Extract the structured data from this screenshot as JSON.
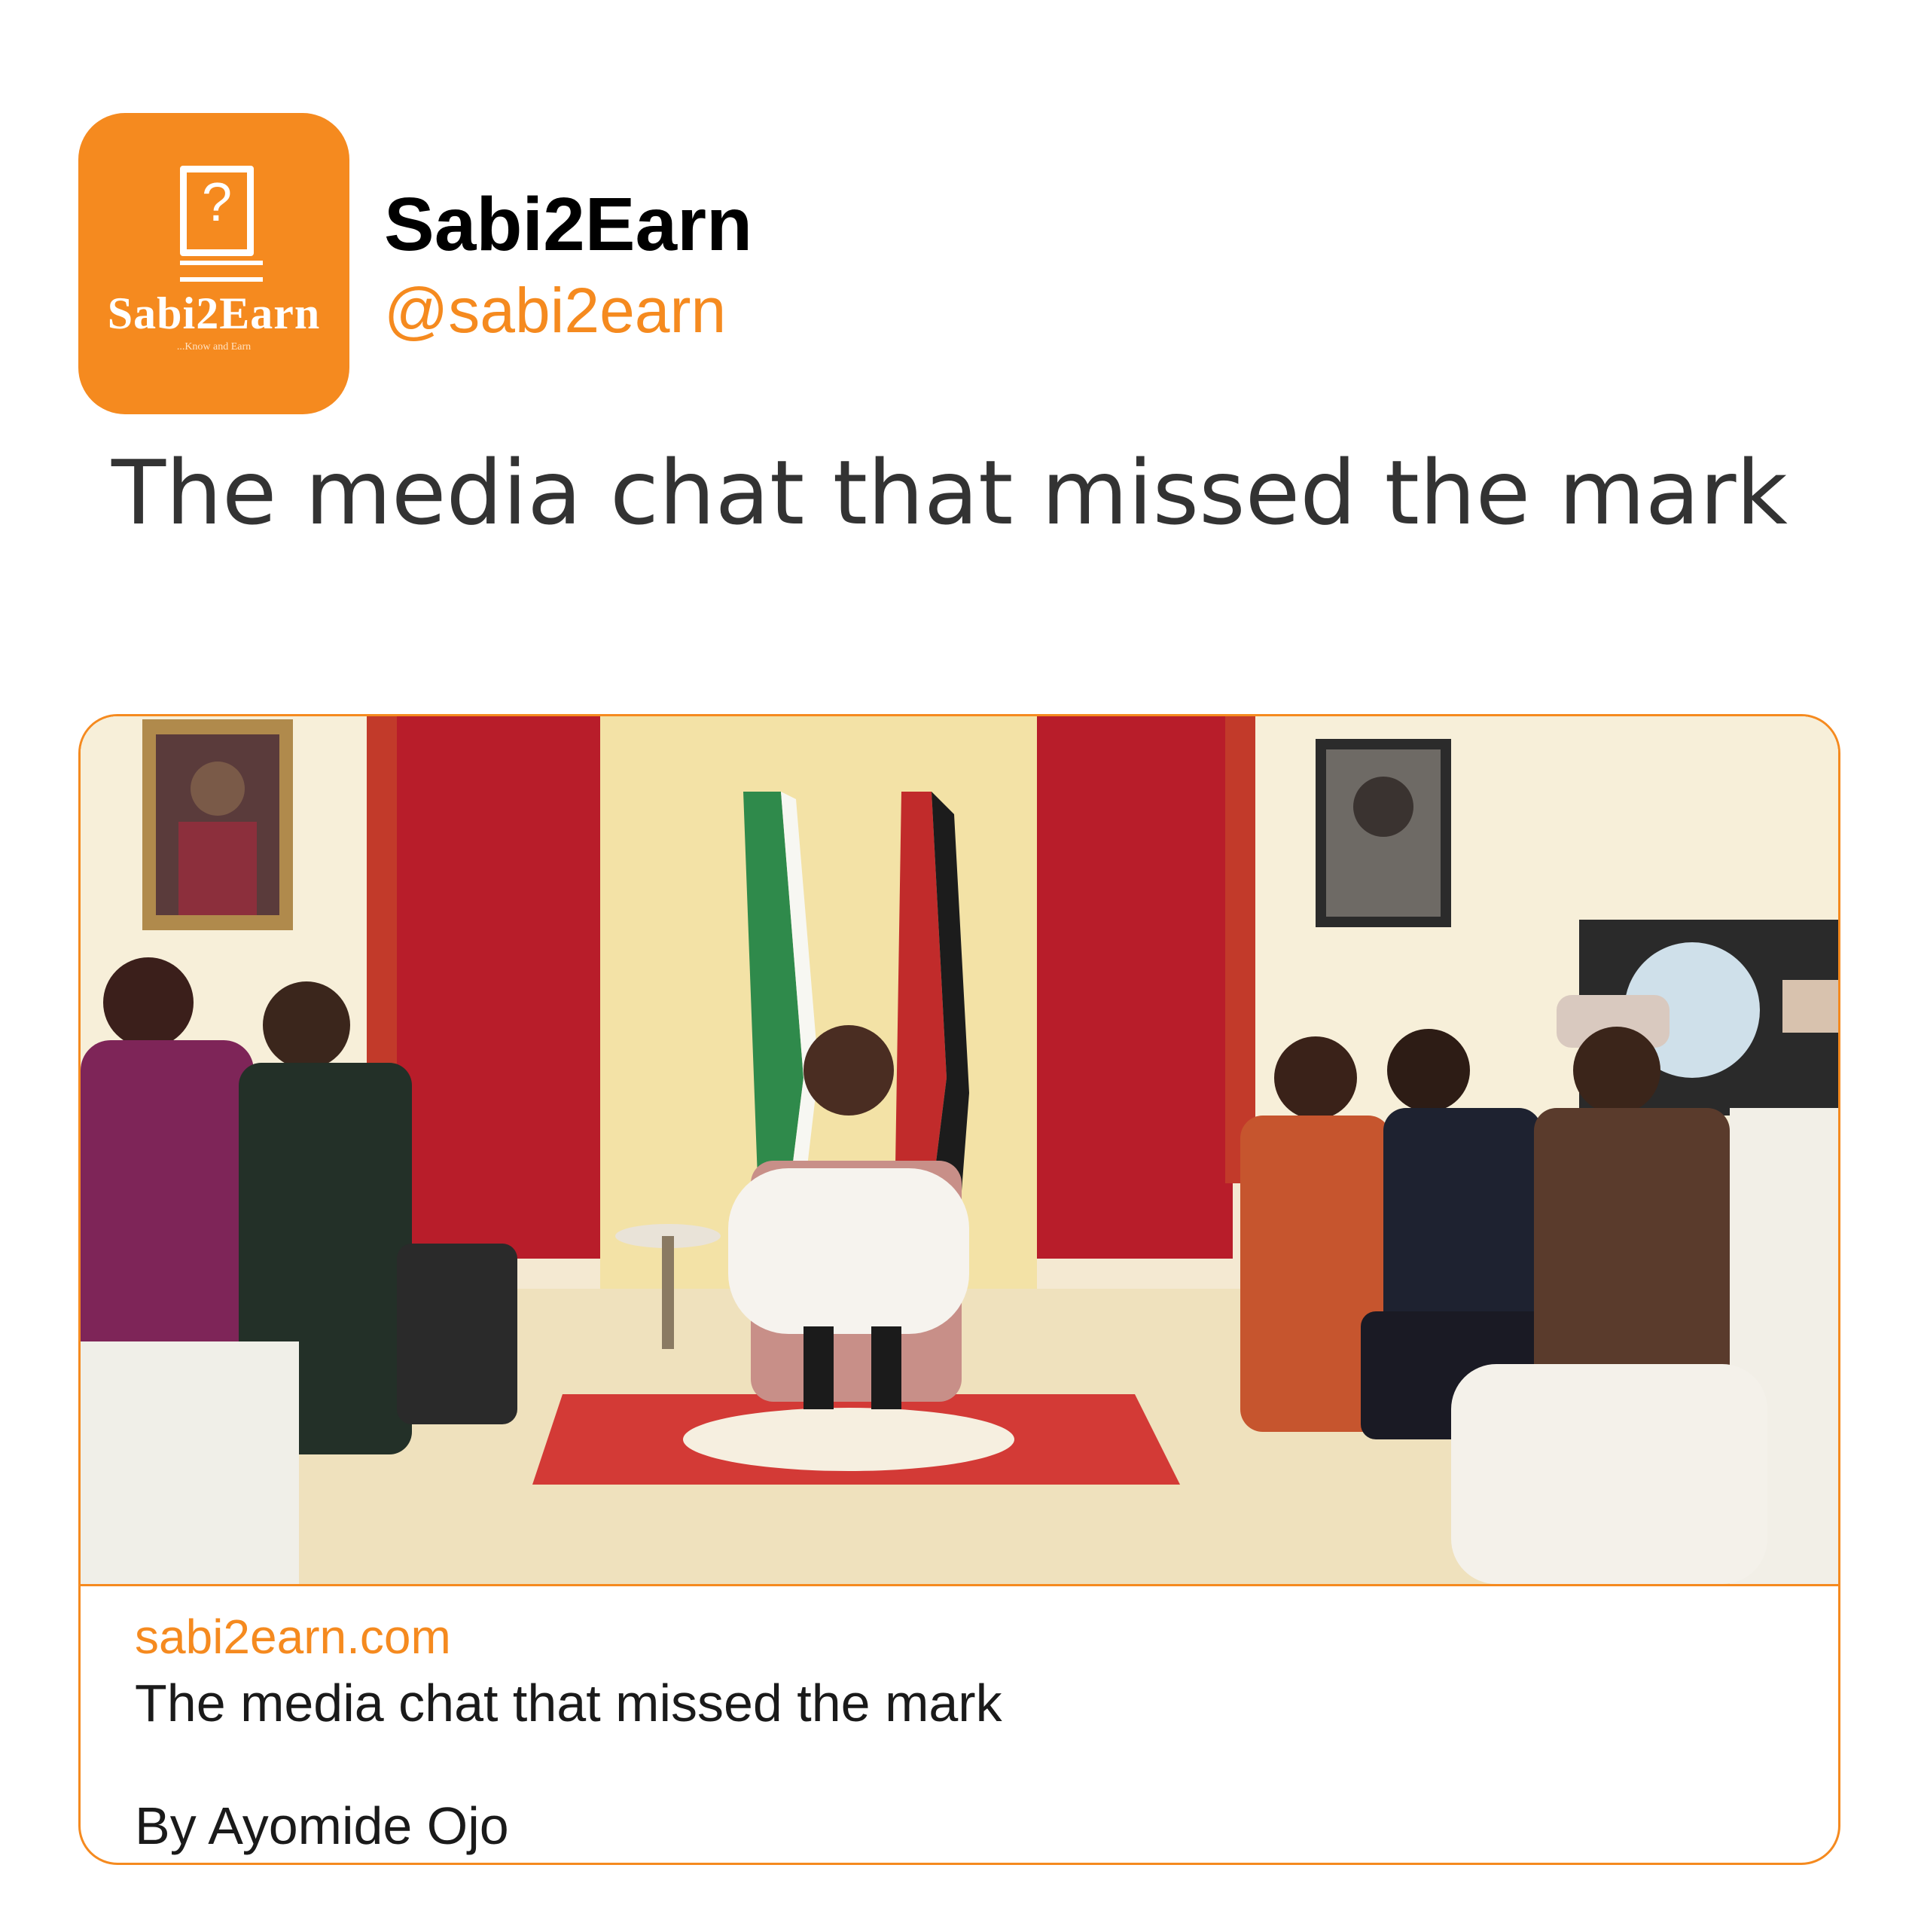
{
  "profile": {
    "name": "Sabi2Earn",
    "handle": "@sabi2earn",
    "avatar_logo_text": "Sabi2Earn",
    "avatar_tagline": "...Know and Earn",
    "avatar_icon": "question-book-icon"
  },
  "post": {
    "text": "The media chat that missed the mark"
  },
  "link_card": {
    "domain": "sabi2earn.com",
    "title": "The media chat that missed the mark",
    "byline": "By Ayomide Ojo"
  },
  "colors": {
    "accent": "#f58a1f",
    "text": "#1a1a1a",
    "background": "#ffffff"
  }
}
